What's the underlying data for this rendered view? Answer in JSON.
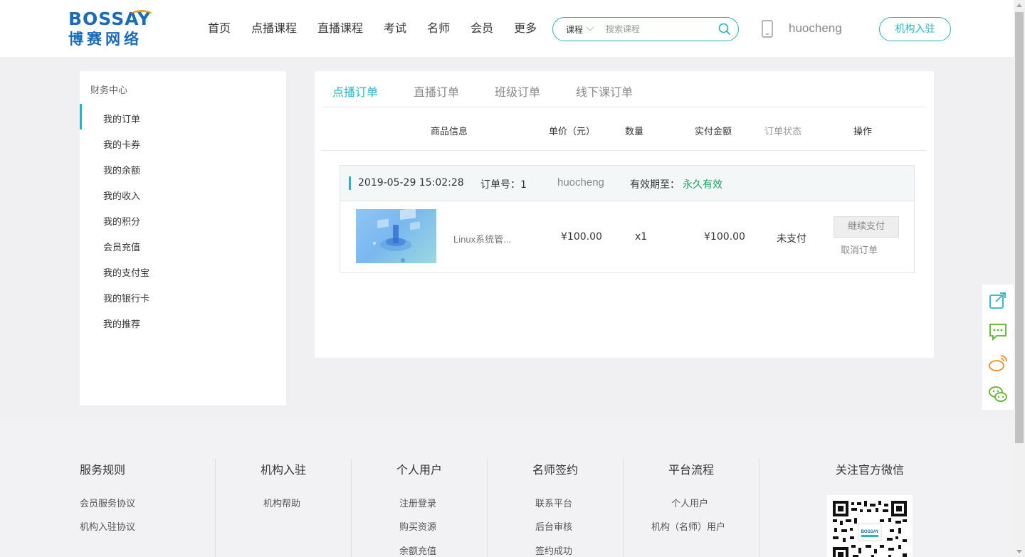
{
  "header": {
    "logo_en": "BOSSAY",
    "logo_cn": "博赛网络",
    "nav": [
      "首页",
      "点播课程",
      "直播课程",
      "考试",
      "名师",
      "会员",
      "更多"
    ],
    "search": {
      "category": "课程",
      "placeholder": "搜索课程"
    },
    "username": "huocheng",
    "join_label": "机构入驻",
    "accent": "#29b3c4"
  },
  "sidebar": {
    "title": "财务中心",
    "items": [
      "我的订单",
      "我的卡券",
      "我的余额",
      "我的收入",
      "我的积分",
      "会员充值",
      "我的支付宝",
      "我的银行卡",
      "我的推荐"
    ],
    "active_index": 0
  },
  "main": {
    "tabs": [
      "点播订单",
      "直播订单",
      "班级订单",
      "线下课订单"
    ],
    "active_tab": 0,
    "columns": [
      "商品信息",
      "单价（元）",
      "数量",
      "实付金额",
      "订单状态",
      "操作"
    ],
    "order": {
      "date": "2019-05-29 15:02:28",
      "order_no": "订单号：1",
      "user": "huocheng",
      "validity_label": "有效期至：",
      "validity_value": "永久有效",
      "course_name": "Linux系统管...",
      "price": "¥100.00",
      "qty": "x1",
      "paid": "¥100.00",
      "status": "未支付",
      "pay_button": "继续支付",
      "cancel_link": "取消订单"
    }
  },
  "float_tools": [
    "share-icon",
    "message-icon",
    "weibo-icon",
    "wechat-icon"
  ],
  "footer": {
    "columns": [
      {
        "title": "服务规则",
        "links": [
          "会员服务协议",
          "机构入驻协议"
        ]
      },
      {
        "title": "机构入驻",
        "links": [
          "机构帮助"
        ]
      },
      {
        "title": "个人用户",
        "links": [
          "注册登录",
          "购买资源",
          "余额充值"
        ]
      },
      {
        "title": "名师签约",
        "links": [
          "联系平台",
          "后台审核",
          "签约成功"
        ]
      },
      {
        "title": "平台流程",
        "links": [
          "个人用户",
          "机构（名师）用户"
        ]
      }
    ],
    "wechat_title": "关注官方微信"
  }
}
